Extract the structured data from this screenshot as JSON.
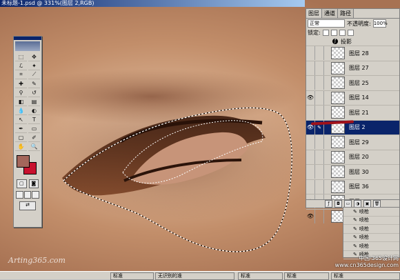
{
  "window": {
    "title": "未标题-1.psd @ 331%(图层 2,RGB)"
  },
  "canvas": {
    "watermark": "Arting365.com"
  },
  "colors": {
    "foreground": "#a3665b",
    "background": "#c8102e",
    "selection": "#0a246a"
  },
  "toolbox": {
    "tools": [
      {
        "icon": "marquee-icon",
        "glyph": "⬚"
      },
      {
        "icon": "move-icon",
        "glyph": "✥"
      },
      {
        "icon": "lasso-icon",
        "glyph": "ℒ"
      },
      {
        "icon": "magic-wand-icon",
        "glyph": "✦"
      },
      {
        "icon": "crop-icon",
        "glyph": "⌗"
      },
      {
        "icon": "slice-icon",
        "glyph": "⟋"
      },
      {
        "icon": "healing-brush-icon",
        "glyph": "✚"
      },
      {
        "icon": "brush-icon",
        "glyph": "✎"
      },
      {
        "icon": "clone-stamp-icon",
        "glyph": "⚲"
      },
      {
        "icon": "history-brush-icon",
        "glyph": "↺"
      },
      {
        "icon": "eraser-icon",
        "glyph": "◧"
      },
      {
        "icon": "gradient-icon",
        "glyph": "▤"
      },
      {
        "icon": "blur-icon",
        "glyph": "💧"
      },
      {
        "icon": "dodge-icon",
        "glyph": "◐"
      },
      {
        "icon": "path-select-icon",
        "glyph": "↖"
      },
      {
        "icon": "type-icon",
        "glyph": "T"
      },
      {
        "icon": "pen-icon",
        "glyph": "✒"
      },
      {
        "icon": "shape-icon",
        "glyph": "▭"
      },
      {
        "icon": "notes-icon",
        "glyph": "▢"
      },
      {
        "icon": "eyedropper-icon",
        "glyph": "✐"
      },
      {
        "icon": "hand-icon",
        "glyph": "✋"
      },
      {
        "icon": "zoom-icon",
        "glyph": "🔍"
      }
    ]
  },
  "layers_palette": {
    "tabs": [
      "图层",
      "通道",
      "路径"
    ],
    "blend_mode": "正常",
    "opacity_label": "不透明度:",
    "opacity_value": "100%",
    "lock_label": "锁定:",
    "effect_label": "投影",
    "layers": [
      {
        "name": "图层 28",
        "visible": false,
        "selected": false
      },
      {
        "name": "图层 27",
        "visible": false,
        "selected": false
      },
      {
        "name": "图层 25",
        "visible": false,
        "selected": false
      },
      {
        "name": "图层 14",
        "visible": true,
        "selected": false
      },
      {
        "name": "图层 21",
        "visible": false,
        "selected": false
      },
      {
        "name": "图层 2",
        "visible": true,
        "selected": true
      },
      {
        "name": "图层 29",
        "visible": false,
        "selected": false
      },
      {
        "name": "图层 20",
        "visible": false,
        "selected": false
      },
      {
        "name": "图层 30",
        "visible": false,
        "selected": false
      },
      {
        "name": "图层 36",
        "visible": false,
        "selected": false
      },
      {
        "name": "图层 33",
        "visible": true,
        "selected": false
      },
      {
        "name": "图层 3",
        "visible": true,
        "selected": false
      }
    ]
  },
  "history_palette": {
    "items": [
      "喷枪",
      "喷枪",
      "喷枪",
      "喷枪",
      "喷枪",
      "喷枪"
    ]
  },
  "site_watermark": {
    "line1": "中国·365设计网",
    "line2": "www.cn365design.com"
  },
  "taskbar": {
    "items": [
      "标准",
      "无识别的准",
      "标准",
      "标准",
      "标准"
    ]
  }
}
